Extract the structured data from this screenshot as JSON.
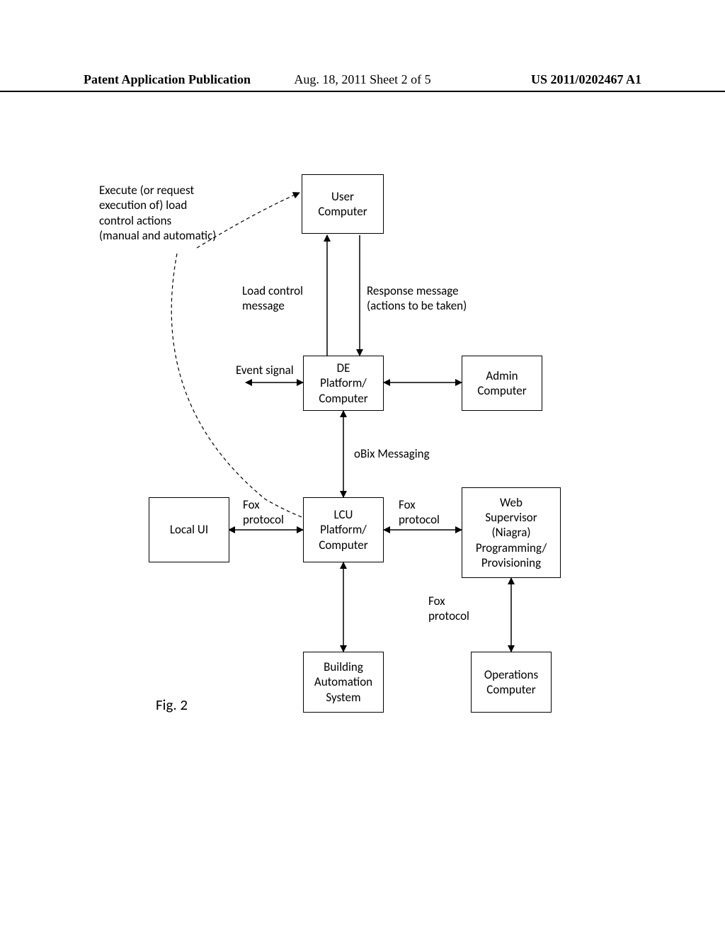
{
  "header": {
    "left": "Patent Application Publication",
    "center": "Aug. 18, 2011  Sheet 2 of 5",
    "right": "US 2011/0202467 A1"
  },
  "figure_label": "Fig. 2",
  "boxes": {
    "user_computer": "User\nComputer",
    "de_platform": "DE\nPlatform/\nComputer",
    "admin_computer": "Admin\nComputer",
    "local_ui": "Local UI",
    "lcu_platform": "LCU\nPlatform/\nComputer",
    "web_supervisor": "Web\nSupervisor\n(Niagra)\nProgramming/\nProvisioning",
    "building_automation": "Building\nAutomation\nSystem",
    "operations_computer": "Operations\nComputer"
  },
  "labels": {
    "execute": "Execute (or request\nexecution of) load\ncontrol actions\n(manual and automatic)",
    "load_control": "Load control\nmessage",
    "response": "Response message\n(actions to be taken)",
    "event_signal": "Event signal",
    "obix": "oBix Messaging",
    "fox1": "Fox\nprotocol",
    "fox2": "Fox\nprotocol",
    "fox3": "Fox\nprotocol"
  }
}
